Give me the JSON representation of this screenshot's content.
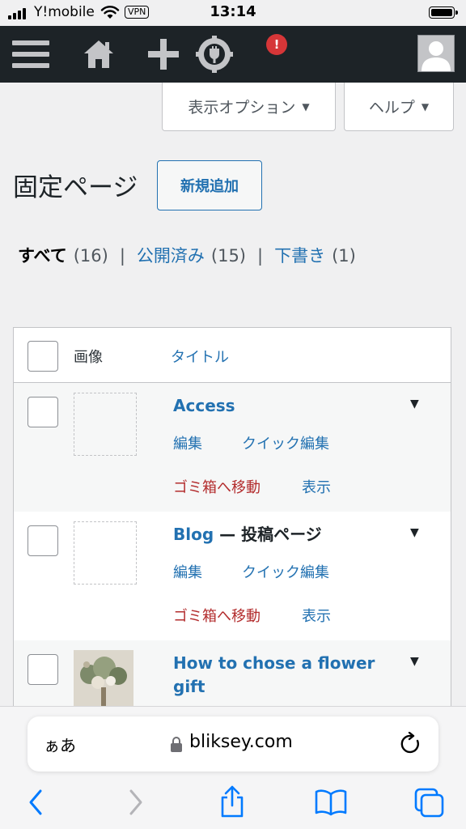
{
  "status_bar": {
    "carrier": "Y!mobile",
    "vpn": "VPN",
    "time": "13:14"
  },
  "admin_bar": {
    "notification_count": "!"
  },
  "tabs": {
    "screen_options": "表示オプション",
    "help": "ヘルプ"
  },
  "heading": {
    "title": "固定ページ",
    "add_new": "新規追加"
  },
  "filters": {
    "all_label": "すべて",
    "all_count": "(16)",
    "published_label": "公開済み",
    "published_count": "(15)",
    "drafts_label": "下書き",
    "drafts_count": "(1)",
    "separator": "|"
  },
  "table": {
    "col_image": "画像",
    "col_title": "タイトル",
    "rows": [
      {
        "title": "Access",
        "state": "",
        "actions": {
          "edit": "編集",
          "quick_edit": "クイック編集",
          "trash": "ゴミ箱へ移動",
          "view": "表示"
        }
      },
      {
        "title": "Blog",
        "state": " — 投稿ページ",
        "actions": {
          "edit": "編集",
          "quick_edit": "クイック編集",
          "trash": "ゴミ箱へ移動",
          "view": "表示"
        }
      },
      {
        "title": "How to chose a flower gift",
        "state": ""
      }
    ]
  },
  "safari": {
    "text_size": "ぁあ",
    "url": "bliksey.com"
  },
  "colors": {
    "admin_bar": "#1d2327",
    "link": "#2271b1",
    "trash": "#b32d2e",
    "notification": "#d63638"
  }
}
